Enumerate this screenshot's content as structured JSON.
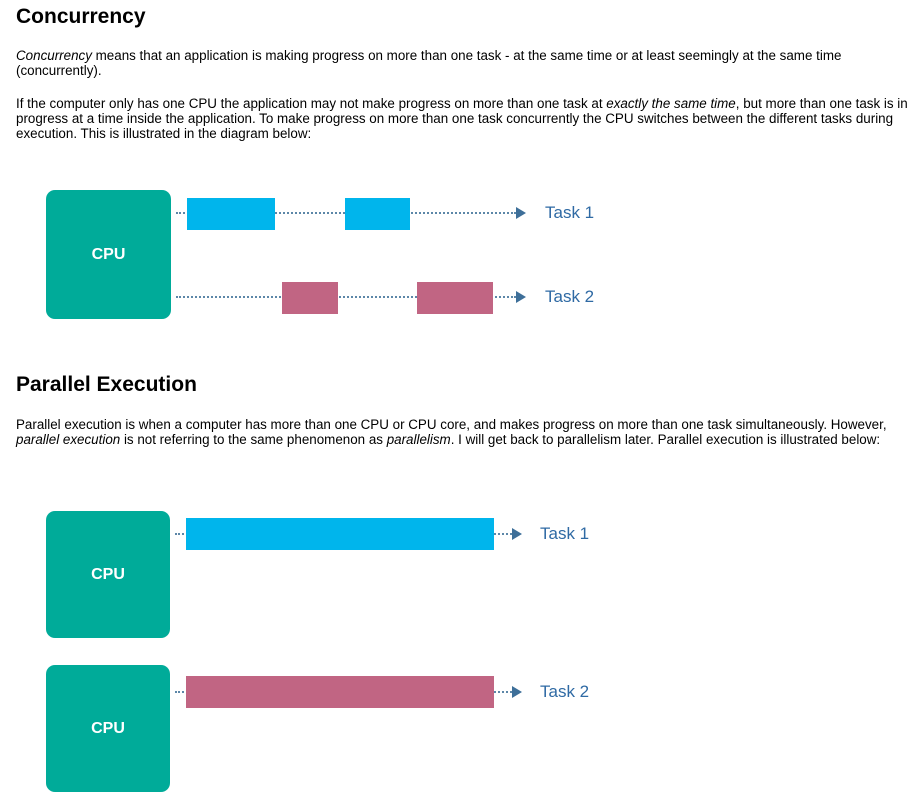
{
  "concurrency": {
    "heading": "Concurrency",
    "p1_term": "Concurrency",
    "p1_rest": " means that an application is making progress on more than one task - at the same time or at least seemingly at the same time (concurrently).",
    "p2_a": "If the computer only has one CPU the application may not make progress on more than one task at ",
    "p2_em": "exactly the same time",
    "p2_b": ", but more than one task is in progress at a time inside the application. To make progress on more than one task concurrently the CPU switches between the different tasks during execution. This is illustrated in the diagram below:",
    "diagram": {
      "cpu_label": "CPU",
      "task1_label": "Task 1",
      "task2_label": "Task 2"
    }
  },
  "parallel": {
    "heading": "Parallel Execution",
    "p1_a": "Parallel execution is when a computer has more than one CPU or CPU core, and makes progress on more than one task simultaneously. However, ",
    "p1_em1": "parallel execution",
    "p1_b": " is not referring to the same phenomenon as ",
    "p1_em2": "parallelism",
    "p1_c": ". I will get back to parallelism later. Parallel execution is illustrated below:",
    "diagram": {
      "cpu1_label": "CPU",
      "cpu2_label": "CPU",
      "task1_label": "Task 1",
      "task2_label": "Task 2"
    }
  },
  "colors": {
    "cpu": "#00ab99",
    "task1_bar": "#00b5ec",
    "task2_bar": "#c16583",
    "task_label": "#2f6aa4",
    "dotted_line": "#5c87a8"
  }
}
